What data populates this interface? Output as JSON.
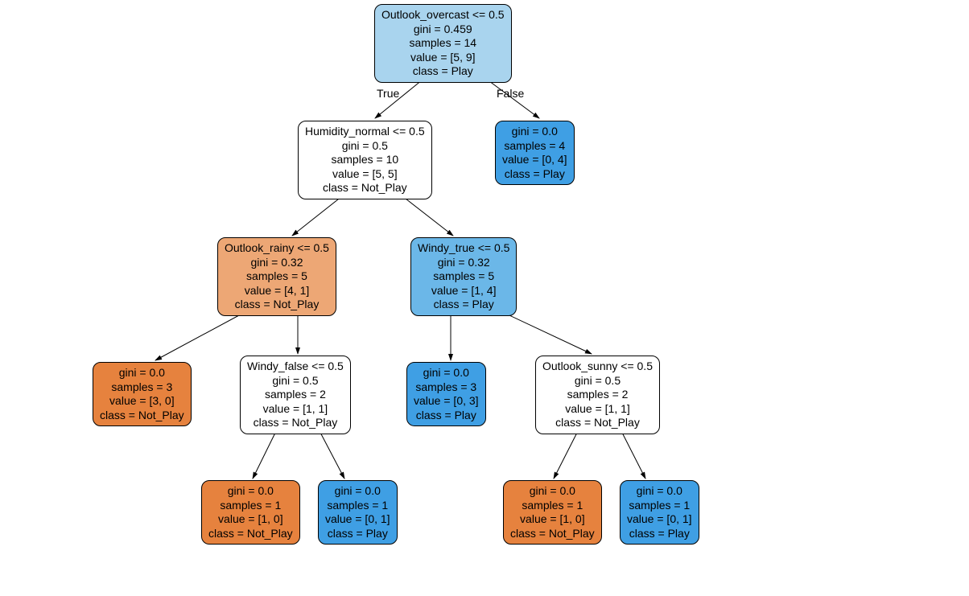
{
  "chart_data": {
    "type": "decision_tree",
    "classes": [
      "Not_Play",
      "Play"
    ],
    "tree": {
      "id": 0,
      "condition": "Outlook_overcast <= 0.5",
      "gini": 0.459,
      "samples": 14,
      "value": [
        5,
        9
      ],
      "class": "Play",
      "true": {
        "id": 1,
        "condition": "Humidity_normal <= 0.5",
        "gini": 0.5,
        "samples": 10,
        "value": [
          5,
          5
        ],
        "class": "Not_Play",
        "true": {
          "id": 3,
          "condition": "Outlook_rainy <= 0.5",
          "gini": 0.32,
          "samples": 5,
          "value": [
            4,
            1
          ],
          "class": "Not_Play",
          "true": {
            "id": 5,
            "gini": 0.0,
            "samples": 3,
            "value": [
              3,
              0
            ],
            "class": "Not_Play"
          },
          "false": {
            "id": 6,
            "condition": "Windy_false <= 0.5",
            "gini": 0.5,
            "samples": 2,
            "value": [
              1,
              1
            ],
            "class": "Not_Play",
            "true": {
              "id": 9,
              "gini": 0.0,
              "samples": 1,
              "value": [
                1,
                0
              ],
              "class": "Not_Play"
            },
            "false": {
              "id": 10,
              "gini": 0.0,
              "samples": 1,
              "value": [
                0,
                1
              ],
              "class": "Play"
            }
          }
        },
        "false": {
          "id": 4,
          "condition": "Windy_true <= 0.5",
          "gini": 0.32,
          "samples": 5,
          "value": [
            1,
            4
          ],
          "class": "Play",
          "true": {
            "id": 7,
            "gini": 0.0,
            "samples": 3,
            "value": [
              0,
              3
            ],
            "class": "Play"
          },
          "false": {
            "id": 8,
            "condition": "Outlook_sunny <= 0.5",
            "gini": 0.5,
            "samples": 2,
            "value": [
              1,
              1
            ],
            "class": "Not_Play",
            "true": {
              "id": 11,
              "gini": 0.0,
              "samples": 1,
              "value": [
                1,
                0
              ],
              "class": "Not_Play"
            },
            "false": {
              "id": 12,
              "gini": 0.0,
              "samples": 1,
              "value": [
                0,
                1
              ],
              "class": "Play"
            }
          }
        }
      },
      "false": {
        "id": 2,
        "gini": 0.0,
        "samples": 4,
        "value": [
          0,
          4
        ],
        "class": "Play"
      }
    }
  },
  "labels": {
    "true": "True",
    "false": "False"
  },
  "nodes": {
    "n0": {
      "l1": "Outlook_overcast <= 0.5",
      "l2": "gini = 0.459",
      "l3": "samples = 14",
      "l4": "value = [5, 9]",
      "l5": "class = Play"
    },
    "n1": {
      "l1": "Humidity_normal <= 0.5",
      "l2": "gini = 0.5",
      "l3": "samples = 10",
      "l4": "value = [5, 5]",
      "l5": "class = Not_Play"
    },
    "n2": {
      "l1": "gini = 0.0",
      "l2": "samples = 4",
      "l3": "value = [0, 4]",
      "l4": "class = Play"
    },
    "n3": {
      "l1": "Outlook_rainy <= 0.5",
      "l2": "gini = 0.32",
      "l3": "samples = 5",
      "l4": "value = [4, 1]",
      "l5": "class = Not_Play"
    },
    "n4": {
      "l1": "Windy_true <= 0.5",
      "l2": "gini = 0.32",
      "l3": "samples = 5",
      "l4": "value = [1, 4]",
      "l5": "class = Play"
    },
    "n5": {
      "l1": "gini = 0.0",
      "l2": "samples = 3",
      "l3": "value = [3, 0]",
      "l4": "class = Not_Play"
    },
    "n6": {
      "l1": "Windy_false <= 0.5",
      "l2": "gini = 0.5",
      "l3": "samples = 2",
      "l4": "value = [1, 1]",
      "l5": "class = Not_Play"
    },
    "n7": {
      "l1": "gini = 0.0",
      "l2": "samples = 3",
      "l3": "value = [0, 3]",
      "l4": "class = Play"
    },
    "n8": {
      "l1": "Outlook_sunny <= 0.5",
      "l2": "gini = 0.5",
      "l3": "samples = 2",
      "l4": "value = [1, 1]",
      "l5": "class = Not_Play"
    },
    "n9": {
      "l1": "gini = 0.0",
      "l2": "samples = 1",
      "l3": "value = [1, 0]",
      "l4": "class = Not_Play"
    },
    "n10": {
      "l1": "gini = 0.0",
      "l2": "samples = 1",
      "l3": "value = [0, 1]",
      "l4": "class = Play"
    },
    "n11": {
      "l1": "gini = 0.0",
      "l2": "samples = 1",
      "l3": "value = [1, 0]",
      "l4": "class = Not_Play"
    },
    "n12": {
      "l1": "gini = 0.0",
      "l2": "samples = 1",
      "l3": "value = [0, 1]",
      "l4": "class = Play"
    }
  },
  "colors": {
    "light_blue": "#a9d4ee",
    "dark_blue": "#3f9fe4",
    "mid_blue": "#6bb7e8",
    "white": "#ffffff",
    "light_orange": "#eda775",
    "dark_orange": "#e6823e"
  }
}
